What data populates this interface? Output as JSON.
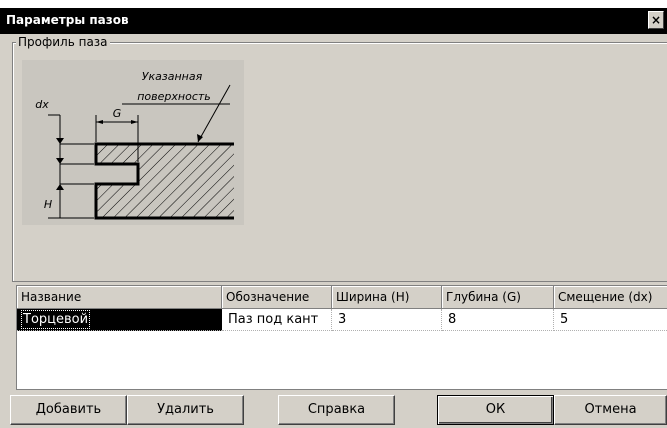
{
  "window": {
    "title": "Параметры пазов",
    "close_glyph": "×"
  },
  "profile_group": {
    "label": "Профиль паза"
  },
  "diagram": {
    "label_surface_line1": "Указанная",
    "label_surface_line2": "поверхность",
    "label_dx": "dx",
    "label_g": "G",
    "label_h": "H"
  },
  "table": {
    "columns": [
      "Название",
      "Обозначение",
      "Ширина (H)",
      "Глубина (G)",
      "Смещение (dx)"
    ],
    "rows": [
      {
        "name": "Торцевой",
        "designation": "Паз под кант",
        "width": "3",
        "depth": "8",
        "offset": "5"
      }
    ]
  },
  "buttons": {
    "add": "Добавить",
    "delete": "Удалить",
    "help": "Справка",
    "ok": "ОК",
    "cancel": "Отмена"
  }
}
